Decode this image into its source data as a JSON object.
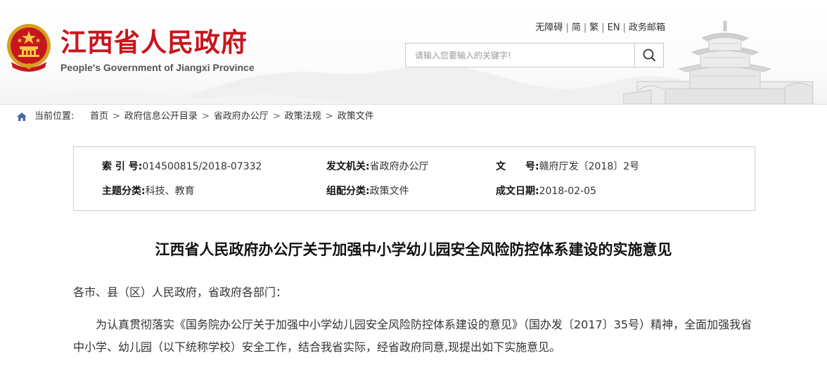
{
  "header": {
    "title": "江西省人民政府",
    "subtitle": "People's Government of Jiangxi Province",
    "top_links": [
      "无障碍",
      "简",
      "繁",
      "EN",
      "政务邮箱"
    ],
    "search_placeholder": "请输入您要输入的关键字!",
    "colors": {
      "brand_red": "#c8161d"
    }
  },
  "breadcrumb": {
    "label": "当前位置:",
    "items": [
      "首页",
      "政府信息公开目录",
      "省政府办公厅",
      "政策法规",
      "政策文件"
    ]
  },
  "meta": {
    "index_no_label": "索 引 号:",
    "index_no": "014500815/2018-07332",
    "issuer_label": "发文机关:",
    "issuer": "省政府办公厅",
    "doc_no_label": "文　　号:",
    "doc_no": "赣府厅发〔2018〕2号",
    "topic_label": "主题分类:",
    "topic": "科技、教育",
    "category_label": "组配分类:",
    "category": "政策文件",
    "date_label": "成文日期:",
    "date": "2018-02-05"
  },
  "document": {
    "title": "江西省人民政府办公厅关于加强中小学幼儿园安全风险防控体系建设的实施意见",
    "salutation": "各市、县（区）人民政府，省政府各部门：",
    "para1_line1": "为认真贯彻落实《国务院办公厅关于加强中小学幼儿园安全风险防控体系建设的意见》（国办发〔2017〕35号）精神，全面加强我省",
    "para1_line2": "中小学、幼儿园（以下统称学校）安全工作，结合我省实际，经省政府同意,现提出如下实施意见。"
  }
}
